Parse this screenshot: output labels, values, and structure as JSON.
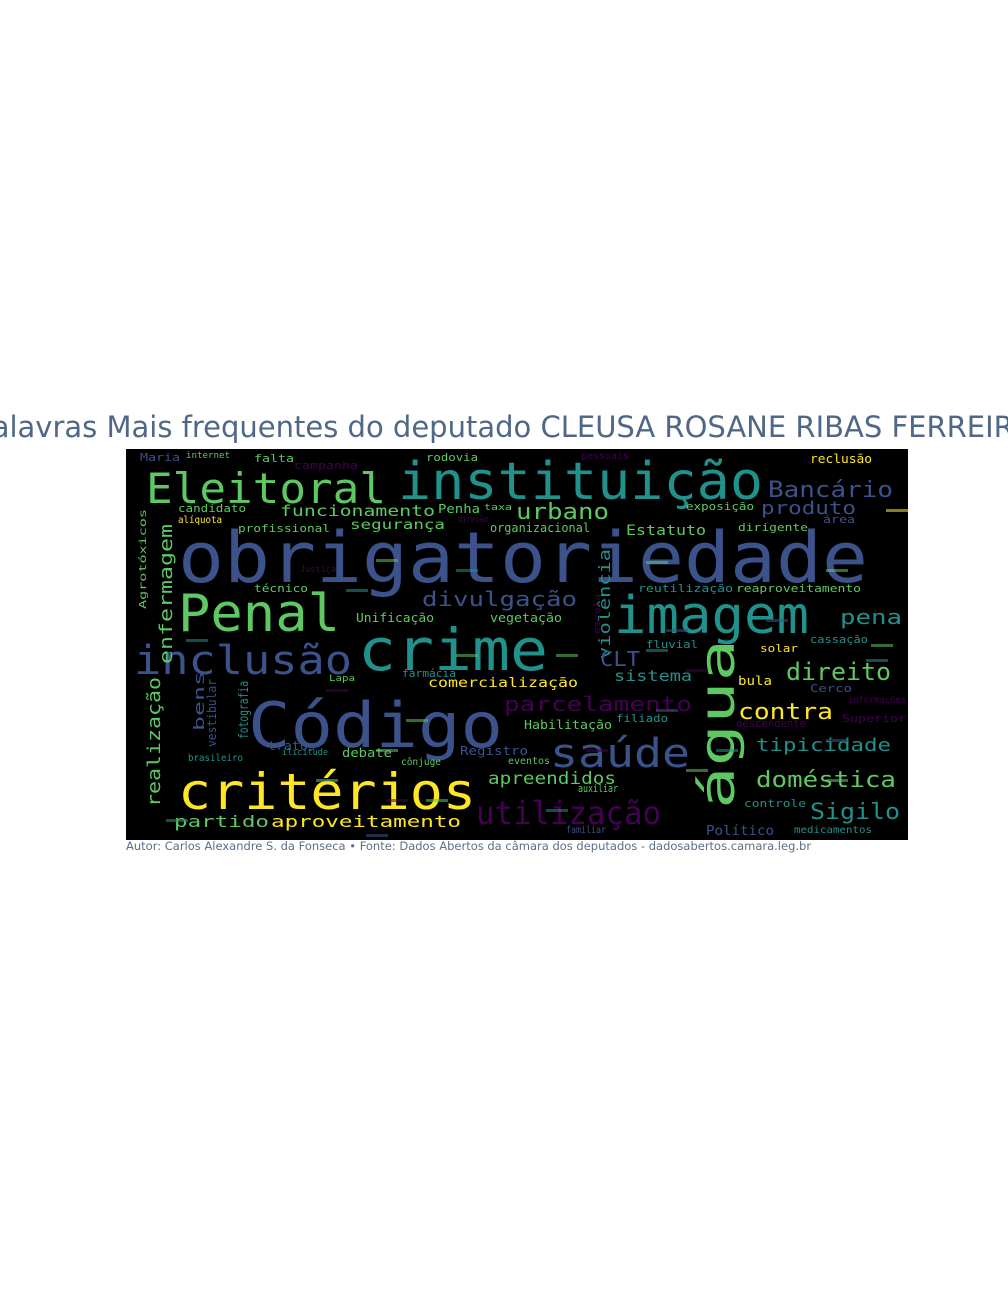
{
  "title": "Palavras Mais frequentes do deputado CLEUSA ROSANE RIBAS FERREIRA",
  "caption": "Autor: Carlos Alexandre S. da Fonseca • Fonte: Dados Abertos da câmara dos deputados - dadosabertos.camara.leg.br",
  "colors": {
    "background": "#000000",
    "title": "#4f6887",
    "palette_blue": "#3b528b",
    "palette_teal": "#21918c",
    "palette_green": "#5ec962",
    "palette_yellow": "#fde725",
    "palette_purple": "#440154"
  },
  "words": [
    "obrigatoriedade",
    "instituição",
    "Eleitoral",
    "Penal",
    "crime",
    "imagem",
    "Código",
    "inclusão",
    "critérios",
    "água",
    "saúde",
    "utilização",
    "Bancário",
    "produto",
    "urbano",
    "divulgação",
    "parcelamento",
    "direito",
    "contra",
    "doméstica",
    "tipicidade",
    "Sigilo",
    "apreendidos",
    "aproveitamento",
    "partido",
    "enfermagem",
    "realização",
    "violência",
    "CLT",
    "pena",
    "bens",
    "funcionamento",
    "segurança",
    "comercialização",
    "Estatuto",
    "sistema",
    "Político",
    "Habilitação",
    "Registro",
    "debate",
    "Unificação",
    "técnico",
    "reaproveitamento",
    "reutilização",
    "fluvial",
    "solar",
    "bula",
    "filiado",
    "descendente",
    "Superior",
    "Cerco",
    "cassação",
    "controle",
    "auxiliar",
    "eventos",
    "cônjuge",
    "fotografia",
    "vestibular",
    "candidato",
    "alíquota",
    "profissional",
    "Penha",
    "organizacional",
    "vegetação",
    "farmácia",
    "tratos",
    "rodovia",
    "pessoais",
    "reclusão",
    "falta",
    "campanha",
    "Maria",
    "internet",
    "área",
    "dirigente",
    "exposição",
    "taxa",
    "direção",
    "medicamentos",
    "familiar",
    "informações",
    "Agrotóxicos",
    "brasileiro",
    "Lapa",
    "Justiça",
    "escola",
    "ilícitude"
  ]
}
